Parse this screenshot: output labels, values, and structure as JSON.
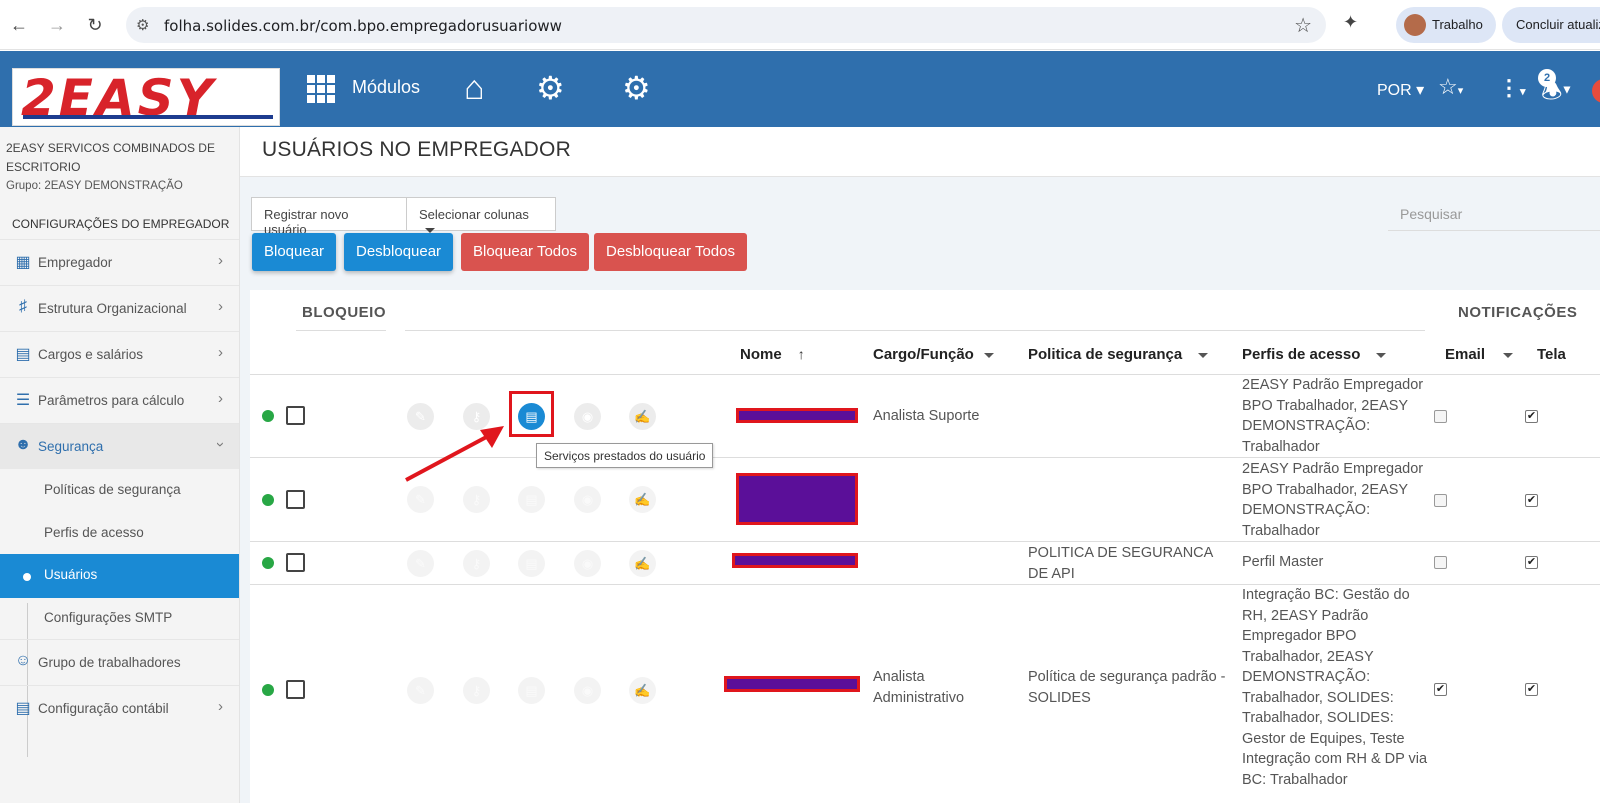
{
  "browser": {
    "url": "folha.solides.com.br/com.bpo.empregadorusuarioww",
    "profile_label": "Trabalho",
    "update_label": "Concluir atualiz",
    "back_icon": "arrow-left-icon",
    "forward_icon": "arrow-right-icon",
    "reload_icon": "reload-icon"
  },
  "header": {
    "logo_text": "2EASY",
    "modulos_label": "Módulos",
    "language": "POR",
    "notification_count": "2",
    "bg_color": "#2f6fad"
  },
  "sidebar": {
    "company_name": "2EASY SERVICOS COMBINADOS DE ESCRITORIO",
    "group_label": "Grupo: 2EASY DEMONSTRAÇÃO",
    "section_title": "CONFIGURAÇÕES DO EMPREGADOR",
    "items": [
      {
        "label": "Empregador",
        "icon": "building-icon"
      },
      {
        "label": "Estrutura Organizacional",
        "icon": "org-chart-icon"
      },
      {
        "label": "Cargos e salários",
        "icon": "id-card-icon"
      },
      {
        "label": "Parâmetros para cálculo",
        "icon": "list-check-icon"
      },
      {
        "label": "Segurança",
        "icon": "user-lock-icon"
      },
      {
        "label": "Grupo de trabalhadores",
        "icon": "users-icon"
      },
      {
        "label": "Configuração contábil",
        "icon": "document-icon"
      }
    ],
    "sub_items": [
      {
        "label": "Políticas de segurança"
      },
      {
        "label": "Perfis de acesso"
      },
      {
        "label": "Usuários"
      },
      {
        "label": "Configurações SMTP"
      }
    ]
  },
  "main": {
    "page_title": "USUÁRIOS NO EMPREGADOR",
    "register_button": "Registrar novo usuário",
    "select_columns_button": "Selecionar colunas",
    "search_placeholder": "Pesquisar",
    "action_buttons": {
      "block": "Bloquear",
      "unblock": "Desbloquear",
      "block_all": "Bloquear Todos",
      "unblock_all": "Desbloquear Todos"
    }
  },
  "table": {
    "group_headers": {
      "block": "BLOQUEIO",
      "notifications": "NOTIFICAÇÕES"
    },
    "columns": {
      "name": "Nome",
      "role": "Cargo/Função",
      "policy": "Politica de segurança",
      "profiles": "Perfis de acesso",
      "email": "Email",
      "screen": "Tela"
    },
    "tooltip": "Serviços prestados do usuário",
    "rows": [
      {
        "role": "Analista Suporte",
        "policy": "",
        "profiles": "2EASY Padrão Empregador BPO Trabalhador, 2EASY DEMONSTRAÇÃO: Trabalhador",
        "email_checked": false,
        "screen_checked": true
      },
      {
        "role": "",
        "policy": "",
        "profiles": "2EASY Padrão Empregador BPO Trabalhador, 2EASY DEMONSTRAÇÃO: Trabalhador",
        "email_checked": false,
        "screen_checked": true
      },
      {
        "role": "",
        "policy": "POLITICA DE SEGURANCA DE API",
        "profiles": "Perfil Master",
        "email_checked": false,
        "screen_checked": true
      },
      {
        "role": "Analista Administrativo",
        "policy": "Política de segurança padrão - SOLIDES",
        "profiles": "Integração BC: Gestão do RH, 2EASY Padrão Empregador BPO Trabalhador, 2EASY DEMONSTRAÇÃO: Trabalhador, SOLIDES: Trabalhador, SOLIDES: Gestor de Equipes, Teste Integração com RH & DP via BC: Trabalhador",
        "email_checked": true,
        "screen_checked": true
      }
    ]
  },
  "colors": {
    "primary": "#1a8ad4",
    "danger": "#d9534f",
    "status_active": "#28a745"
  }
}
